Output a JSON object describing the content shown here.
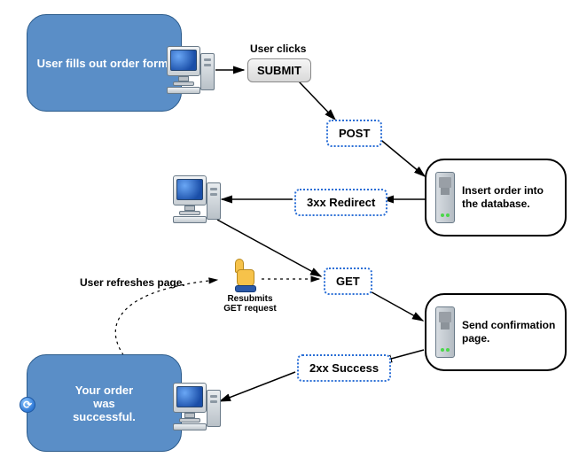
{
  "boxes": {
    "orderForm": "User fills out order form.",
    "orderSuccess": "Your order\nwas\nsuccessful."
  },
  "servers": {
    "insert": "Insert order into the database.",
    "confirm": "Send confirmation page."
  },
  "http": {
    "post": "POST",
    "redirect": "3xx Redirect",
    "get": "GET",
    "success": "2xx Success"
  },
  "labels": {
    "userClicks": "User clicks",
    "submit": "SUBMIT",
    "resubmits": "Resubmits\nGET request",
    "refreshes": "User refreshes page."
  }
}
